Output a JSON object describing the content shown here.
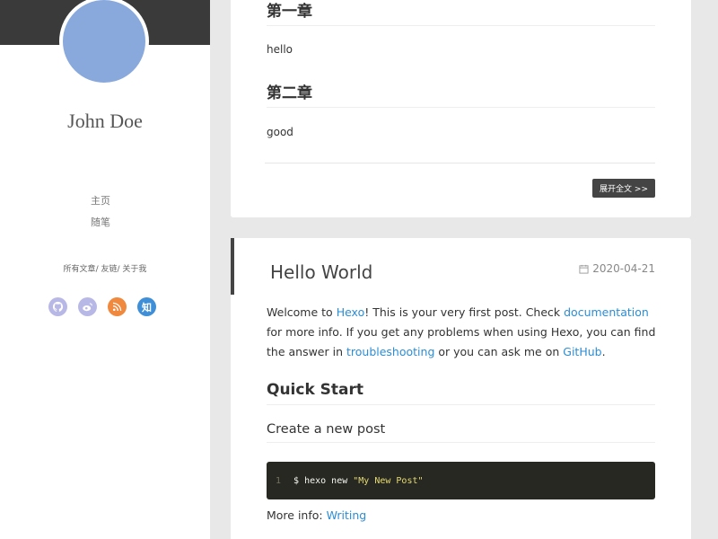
{
  "sidebar": {
    "author": "John Doe",
    "nav": [
      "主页",
      "随笔"
    ],
    "sub_links": [
      "所有文章",
      "友链",
      "关于我"
    ],
    "sub_separator": "/",
    "social": [
      {
        "name": "github-icon",
        "color": "#b8b8e6"
      },
      {
        "name": "weibo-icon",
        "color": "#b8b8e6"
      },
      {
        "name": "rss-icon",
        "color": "#f0883e"
      },
      {
        "name": "zhihu-icon",
        "color": "#3f8fd8",
        "text": "知"
      }
    ]
  },
  "post1": {
    "h1": "第一章",
    "p1": "hello",
    "h2": "第二章",
    "p2": "good",
    "read_more": "展开全文 >>"
  },
  "post2": {
    "title": "Hello World",
    "date": "2020-04-21",
    "intro": {
      "t1": "Welcome to ",
      "hexo": "Hexo",
      "t2": "! This is your very first post. Check ",
      "documentation": "documentation",
      "t3": " for more info. If you get any problems when using Hexo, you can find the answer in ",
      "troubleshooting": "troubleshooting",
      "t4": " or you can ask me on ",
      "github": "GitHub",
      "t5": "."
    },
    "quick_start": "Quick Start",
    "create_post": "Create a new post",
    "code": {
      "line_no": "1",
      "command": "$ hexo new",
      "string": "\"My New Post\""
    },
    "more_info_label": "More info: ",
    "more_info_link": "Writing"
  },
  "colors": {
    "link": "#2b8dd6",
    "avatar": "#89a9dc",
    "banner": "#3a3a3a"
  }
}
